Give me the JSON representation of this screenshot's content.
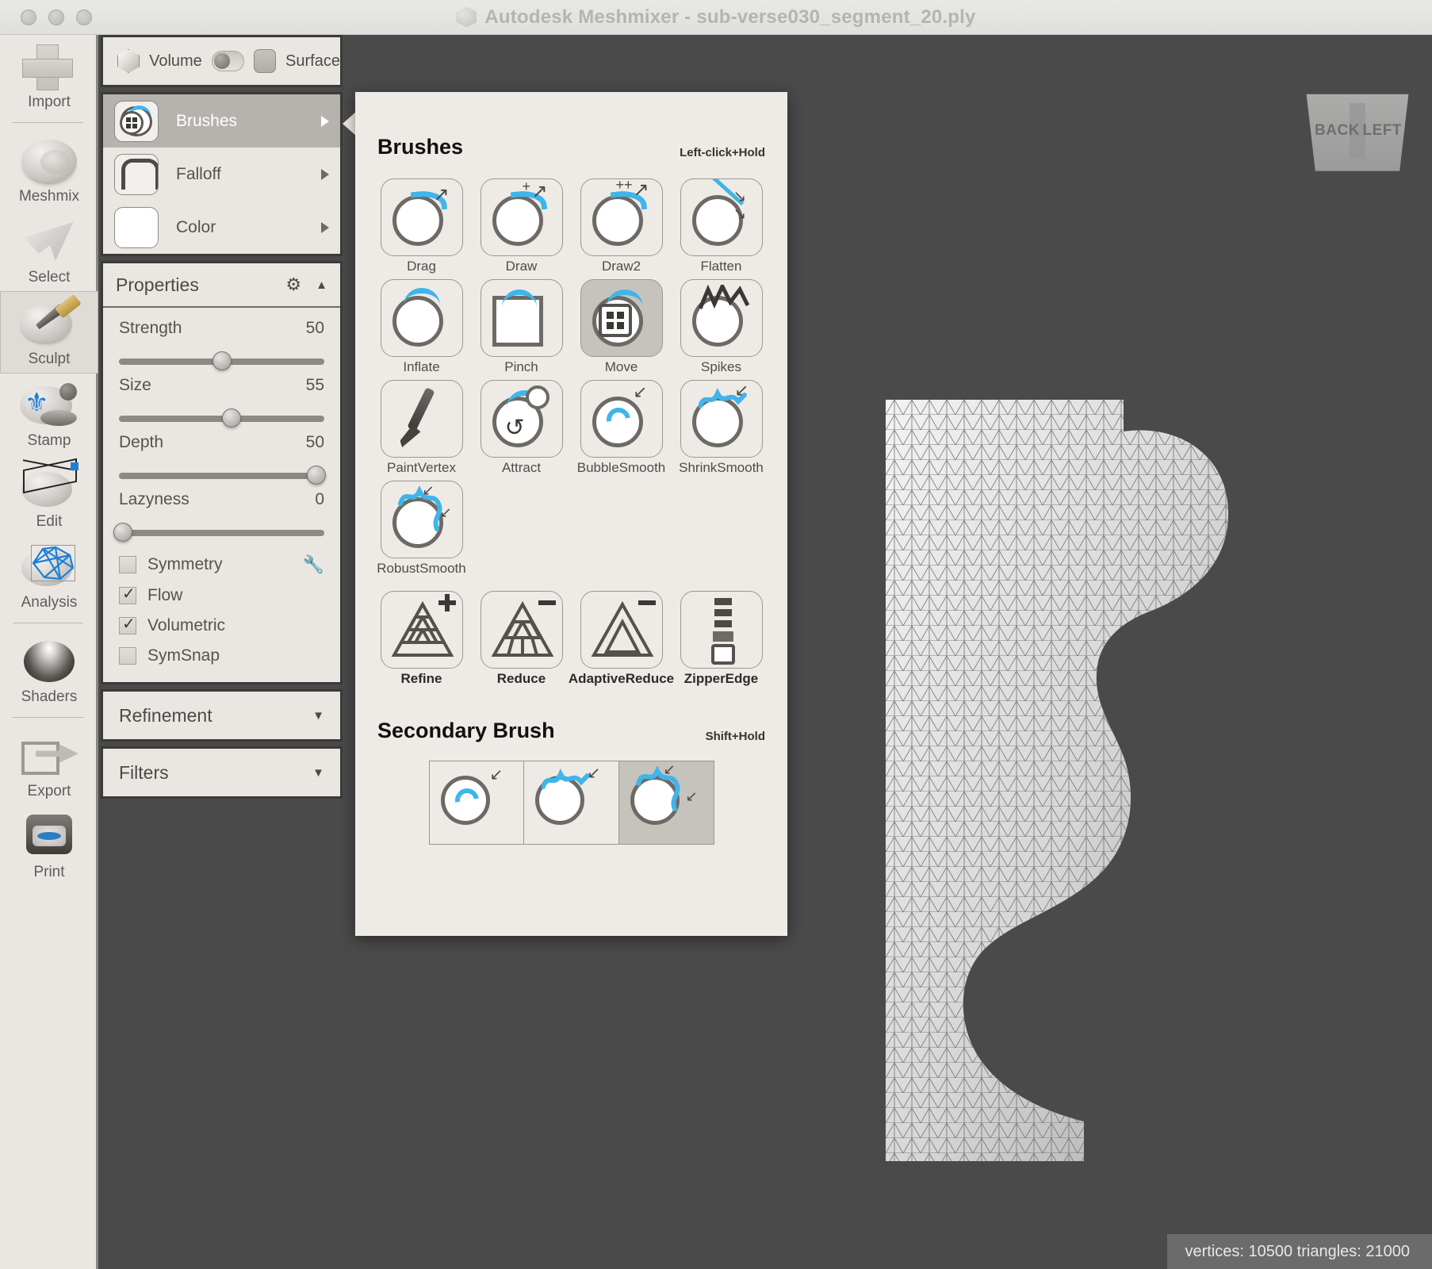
{
  "titlebar": {
    "title": "Autodesk Meshmixer - sub-verse030_segment_20.ply",
    "app_icon": "meshmixer-cube-icon",
    "window_buttons": [
      "close",
      "minimize",
      "zoom"
    ]
  },
  "left_toolbar": {
    "items": [
      {
        "label": "Import",
        "icon": "plus-icon",
        "selected": false
      },
      {
        "label": "Meshmix",
        "icon": "face-sphere-icon",
        "selected": false
      },
      {
        "label": "Select",
        "icon": "lasso-arrow-icon",
        "selected": false
      },
      {
        "label": "Sculpt",
        "icon": "brush-sphere-icon",
        "selected": true
      },
      {
        "label": "Stamp",
        "icon": "stamp-icon",
        "selected": false
      },
      {
        "label": "Edit",
        "icon": "wireframe-icon",
        "selected": false
      },
      {
        "label": "Analysis",
        "icon": "mesh-analysis-icon",
        "selected": false
      },
      {
        "label": "Shaders",
        "icon": "shader-sphere-icon",
        "selected": false
      },
      {
        "label": "Export",
        "icon": "export-arrow-icon",
        "selected": false
      },
      {
        "label": "Print",
        "icon": "printer-icon",
        "selected": false
      }
    ]
  },
  "mode_bar": {
    "volume_label": "Volume",
    "surface_label": "Surface",
    "volume_icon": "cube-icon",
    "surface_icon": "rounded-square-icon",
    "toggle_state": "off"
  },
  "tool_rows": [
    {
      "label": "Brushes",
      "icon": "brush-swatch-icon",
      "active": true
    },
    {
      "label": "Falloff",
      "icon": "falloff-curve-icon",
      "active": false
    },
    {
      "label": "Color",
      "icon": "color-swatch-icon",
      "active": false
    }
  ],
  "properties": {
    "title": "Properties",
    "gear_icon": "gear-icon",
    "collapse_icon": "caret-up-icon",
    "wrench_icon": "wrench-icon",
    "sliders": [
      {
        "name": "Strength",
        "value": "50",
        "percent": 50
      },
      {
        "name": "Size",
        "value": "55",
        "percent": 55
      },
      {
        "name": "Depth",
        "value": "50",
        "percent": 96
      },
      {
        "name": "Lazyness",
        "value": "0",
        "percent": 2
      }
    ],
    "checkboxes": [
      {
        "label": "Symmetry",
        "checked": false
      },
      {
        "label": "Flow",
        "checked": true
      },
      {
        "label": "Volumetric",
        "checked": true
      },
      {
        "label": "SymSnap",
        "checked": false
      }
    ]
  },
  "collapsed_sections": [
    {
      "title": "Refinement",
      "caret": "caret-down-icon"
    },
    {
      "title": "Filters",
      "caret": "caret-down-icon"
    }
  ],
  "popup": {
    "brushes": {
      "heading": "Brushes",
      "hint": "Left-click+Hold",
      "items": [
        {
          "label": "Drag",
          "icon": "drag-brush-icon",
          "selected": false
        },
        {
          "label": "Draw",
          "icon": "draw-brush-icon",
          "selected": false
        },
        {
          "label": "Draw2",
          "icon": "draw2-brush-icon",
          "selected": false
        },
        {
          "label": "Flatten",
          "icon": "flatten-brush-icon",
          "selected": false
        },
        {
          "label": "Inflate",
          "icon": "inflate-brush-icon",
          "selected": false
        },
        {
          "label": "Pinch",
          "icon": "pinch-brush-icon",
          "selected": false
        },
        {
          "label": "Move",
          "icon": "move-brush-icon",
          "selected": true
        },
        {
          "label": "Spikes",
          "icon": "spikes-brush-icon",
          "selected": false
        },
        {
          "label": "PaintVertex",
          "icon": "paintvertex-brush-icon",
          "selected": false
        },
        {
          "label": "Attract",
          "icon": "attract-brush-icon",
          "selected": false
        },
        {
          "label": "BubbleSmooth",
          "icon": "bubblesmooth-brush-icon",
          "selected": false
        },
        {
          "label": "ShrinkSmooth",
          "icon": "shrinksmooth-brush-icon",
          "selected": false
        },
        {
          "label": "RobustSmooth",
          "icon": "robustsmooth-brush-icon",
          "selected": false
        }
      ],
      "mesh_ops": [
        {
          "label": "Refine",
          "icon": "refine-icon"
        },
        {
          "label": "Reduce",
          "icon": "reduce-icon"
        },
        {
          "label": "AdaptiveReduce",
          "icon": "adaptive-reduce-icon"
        },
        {
          "label": "ZipperEdge",
          "icon": "zipper-edge-icon"
        }
      ]
    },
    "secondary_brush": {
      "heading": "Secondary Brush",
      "hint": "Shift+Hold",
      "items": [
        {
          "icon": "bubblesmooth-secondary-icon",
          "selected": false
        },
        {
          "icon": "shrinksmooth-secondary-icon",
          "selected": false
        },
        {
          "icon": "robustsmooth-secondary-icon",
          "selected": true
        }
      ]
    }
  },
  "viewport": {
    "nav_cube": {
      "back_label": "BACK",
      "left_label": "LEFT"
    },
    "status": "vertices: 10500 triangles: 21000"
  },
  "colors": {
    "panel_bg": "#eae7e2",
    "popup_bg": "#eeebe6",
    "viewport_bg": "#4a4a4a",
    "accent_blue": "#3fb5ea",
    "selection_gray": "#c6c3bd",
    "active_row": "#b6b3ae",
    "title_text": "#b4b4b2"
  }
}
